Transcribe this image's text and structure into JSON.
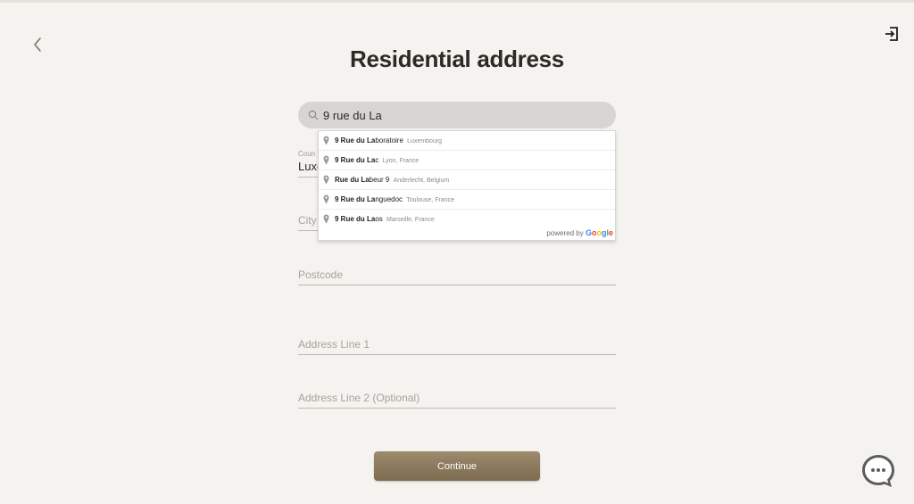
{
  "header": {
    "title": "Residential address",
    "back_icon": "chevron-left-icon",
    "exit_icon": "logout-icon"
  },
  "search": {
    "value": "9 rue du La",
    "icon": "search-icon"
  },
  "form": {
    "country_label": "Coun",
    "country_value": "Luxe",
    "city_placeholder": "City",
    "postcode_placeholder": "Postcode",
    "address1_placeholder": "Address Line 1",
    "address2_placeholder": "Address Line 2 (Optional)"
  },
  "suggestions": [
    {
      "bold": "9 Rue du La",
      "rest": "boratoire",
      "secondary": "Luxembourg"
    },
    {
      "bold": "9 Rue du La",
      "rest": "c",
      "secondary": "Lyon, France"
    },
    {
      "bold": "Rue du La",
      "rest": "beur 9",
      "secondary": "Anderlecht, Belgium",
      "rest_bold_tail": "9"
    },
    {
      "bold": "9 Rue du La",
      "rest": "nguedoc",
      "secondary": "Toulouse, France"
    },
    {
      "bold": "9 Rue du La",
      "rest": "os",
      "secondary": "Marseille, France"
    }
  ],
  "powered_by": "powered by",
  "google_logo": "Google",
  "continue_label": "Continue",
  "chat_icon": "chat-bubble-icon",
  "colors": {
    "background": "#f5f3ef",
    "button": "#8a7758",
    "chat": "#5a5a5a"
  }
}
